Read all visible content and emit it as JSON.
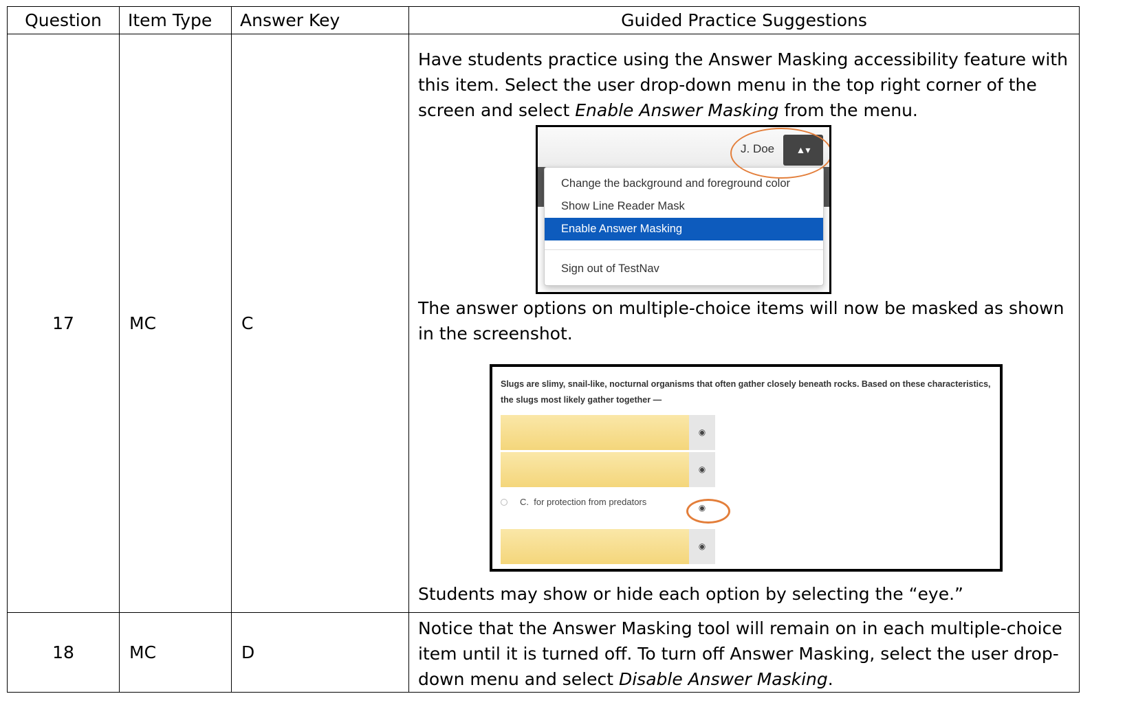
{
  "header": {
    "question": "Question",
    "item_type": "Item Type",
    "answer_key": "Answer Key",
    "guided": "Guided Practice Suggestions"
  },
  "rows": [
    {
      "question": "17",
      "item_type": "MC",
      "answer_key": "C",
      "para1_a": "Have students practice using the Answer Masking accessibility feature with this item.  Select the user drop-down menu in the top right corner of the screen and select ",
      "para1_em": "Enable Answer Masking",
      "para1_b": " from the menu.",
      "para2": "The answer options on multiple-choice items will now be masked as shown in the screenshot.",
      "para3": "Students may show or hide each option by selecting the “eye.”"
    },
    {
      "question": "18",
      "item_type": "MC",
      "answer_key": "D",
      "para1_a": "Notice that the Answer Masking tool will remain on in each multiple-choice item until it is turned off. To turn off Answer Masking, select the user drop-down menu and select ",
      "para1_em": "Disable Answer Masking",
      "para1_b": "."
    }
  ],
  "menu_screenshot": {
    "user_name": "J. Doe",
    "items": [
      "Change the background and foreground color",
      "Show Line Reader Mask",
      "Enable Answer Masking",
      "Sign out of TestNav"
    ],
    "highlight_color": "#0d5bbd",
    "callout_color": "#e37e3a"
  },
  "masking_screenshot": {
    "stem": "Slugs are slimy, snail-like, nocturnal organisms that often gather closely beneath rocks. Based on these characteristics, the slugs most likely gather together —",
    "option_letter": "C.",
    "option_text": "for protection from predators",
    "mask_color": "#f4d67b"
  }
}
